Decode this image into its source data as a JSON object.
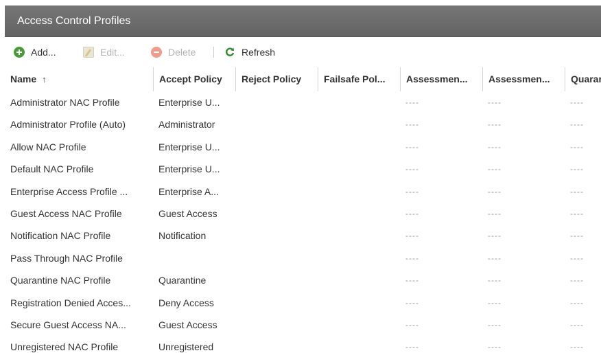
{
  "window": {
    "title": "Access Control Profiles"
  },
  "toolbar": {
    "add_label": "Add...",
    "edit_label": "Edit...",
    "delete_label": "Delete",
    "refresh_label": "Refresh"
  },
  "table": {
    "columns": [
      "Name",
      "Accept Policy",
      "Reject Policy",
      "Failsafe Pol...",
      "Assessmen...",
      "Assessmen...",
      "Quarar"
    ],
    "sort": {
      "column": "Name",
      "icon": "sort-ascending-icon"
    },
    "rows": [
      [
        "Administrator NAC Profile",
        "Enterprise U...",
        "",
        "",
        "----",
        "----",
        "----"
      ],
      [
        "Administrator Profile (Auto)",
        "Administrator",
        "",
        "",
        "----",
        "----",
        "----"
      ],
      [
        "Allow NAC Profile",
        "Enterprise U...",
        "",
        "",
        "----",
        "----",
        "----"
      ],
      [
        "Default NAC Profile",
        "Enterprise U...",
        "",
        "",
        "----",
        "----",
        "----"
      ],
      [
        "Enterprise Access Profile ...",
        "Enterprise A...",
        "",
        "",
        "----",
        "----",
        "----"
      ],
      [
        "Guest Access NAC Profile",
        "Guest Access",
        "",
        "",
        "----",
        "----",
        "----"
      ],
      [
        "Notification NAC Profile",
        "Notification",
        "",
        "",
        "----",
        "----",
        "----"
      ],
      [
        "Pass Through NAC Profile",
        "",
        "",
        "",
        "----",
        "----",
        "----"
      ],
      [
        "Quarantine NAC Profile",
        "Quarantine",
        "",
        "",
        "----",
        "----",
        "----"
      ],
      [
        "Registration Denied Acces...",
        "Deny Access",
        "",
        "",
        "----",
        "----",
        "----"
      ],
      [
        "Secure Guest Access NA...",
        "Guest Access",
        "",
        "",
        "----",
        "----",
        "----"
      ],
      [
        "Unregistered NAC Profile",
        "Unregistered",
        "",
        "",
        "----",
        "----",
        "----"
      ]
    ]
  },
  "colors": {
    "titlebar": "#6b6b6b",
    "add_icon": "#4a9a3c",
    "refresh_icon": "#2e8b2e",
    "delete_icon": "#ef9b8e"
  }
}
